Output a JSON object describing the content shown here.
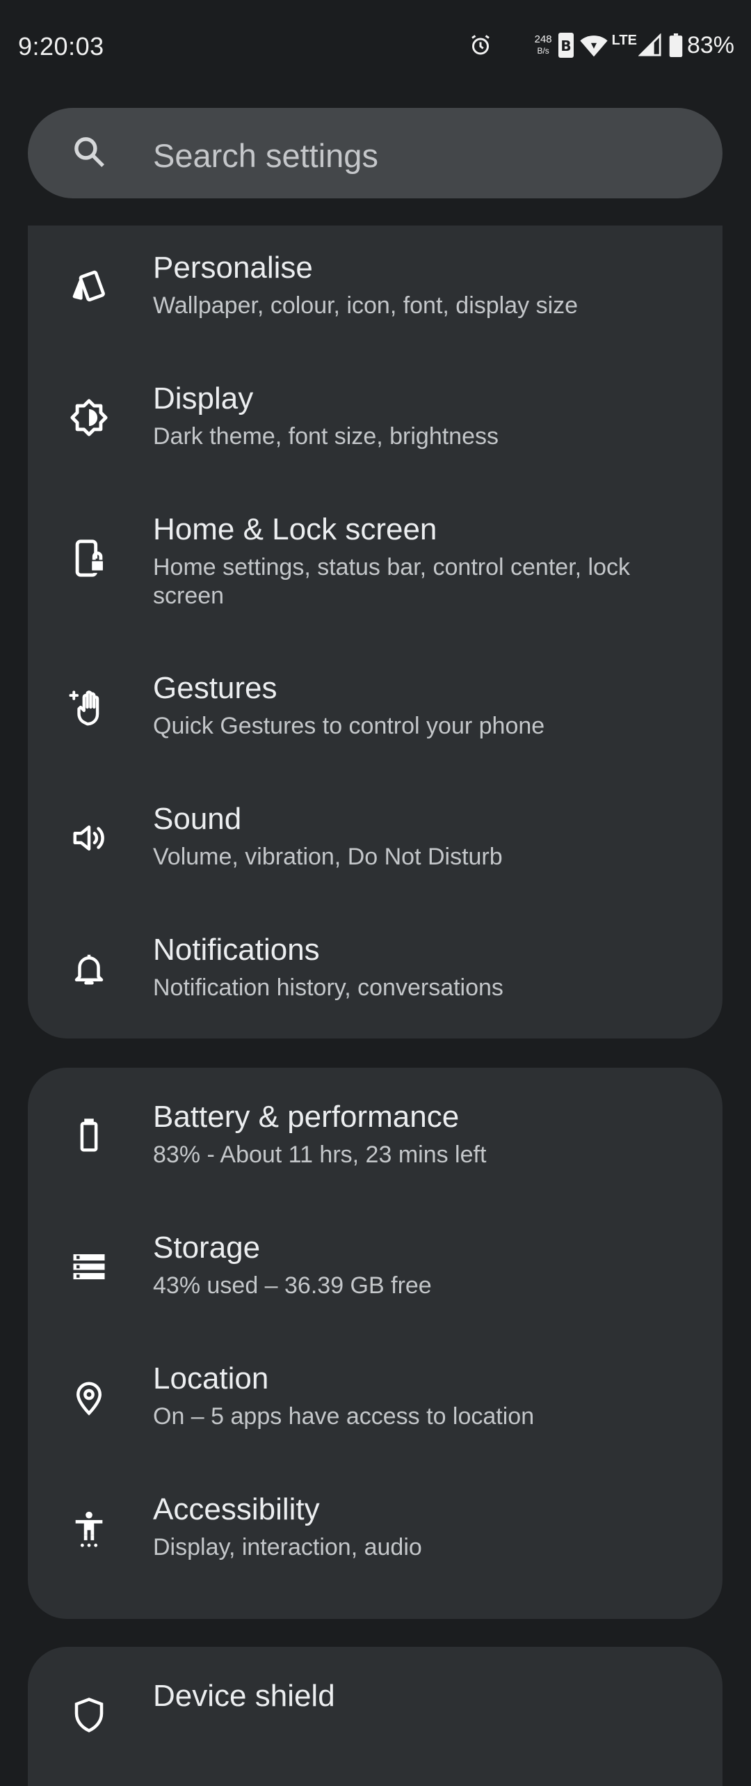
{
  "status_bar": {
    "time": "9:20:03",
    "net_speed_value": "248",
    "net_speed_unit": "B/s",
    "network_type": "LTE",
    "battery_percent": "83%",
    "icons": [
      "alarm-icon",
      "sim-b-icon",
      "wifi-icon",
      "signal-icon",
      "battery-icon"
    ]
  },
  "search": {
    "placeholder": "Search settings",
    "icon": "search-icon"
  },
  "section1": {
    "items": [
      {
        "title": "Personalise",
        "subtitle": "Wallpaper, colour, icon, font, display size",
        "icon": "personalise-icon"
      },
      {
        "title": "Display",
        "subtitle": "Dark theme, font size, brightness",
        "icon": "display-brightness-icon"
      },
      {
        "title": "Home & Lock screen",
        "subtitle": "Home settings, status bar, control center, lock screen",
        "icon": "phone-lock-icon"
      },
      {
        "title": "Gestures",
        "subtitle": "Quick Gestures to control your phone",
        "icon": "gesture-hand-icon"
      },
      {
        "title": "Sound",
        "subtitle": "Volume, vibration, Do Not Disturb",
        "icon": "speaker-icon"
      },
      {
        "title": "Notifications",
        "subtitle": "Notification history, conversations",
        "icon": "bell-icon"
      }
    ]
  },
  "section2": {
    "items": [
      {
        "title": "Battery & performance",
        "subtitle": "83% - About 11 hrs, 23 mins left",
        "icon": "battery-icon"
      },
      {
        "title": "Storage",
        "subtitle": "43% used – 36.39 GB free",
        "icon": "storage-icon"
      },
      {
        "title": "Location",
        "subtitle": "On – 5 apps have access to location",
        "icon": "location-pin-icon"
      },
      {
        "title": "Accessibility",
        "subtitle": "Display, interaction, audio",
        "icon": "accessibility-icon"
      }
    ]
  },
  "section3": {
    "items": [
      {
        "title": "Device shield",
        "icon": "shield-icon"
      }
    ]
  },
  "colors": {
    "background": "#1b1d1f",
    "card": "#2d3033",
    "search_bar": "#44474a",
    "title_text": "#eceef0",
    "subtitle_text": "#c4c7ca"
  }
}
